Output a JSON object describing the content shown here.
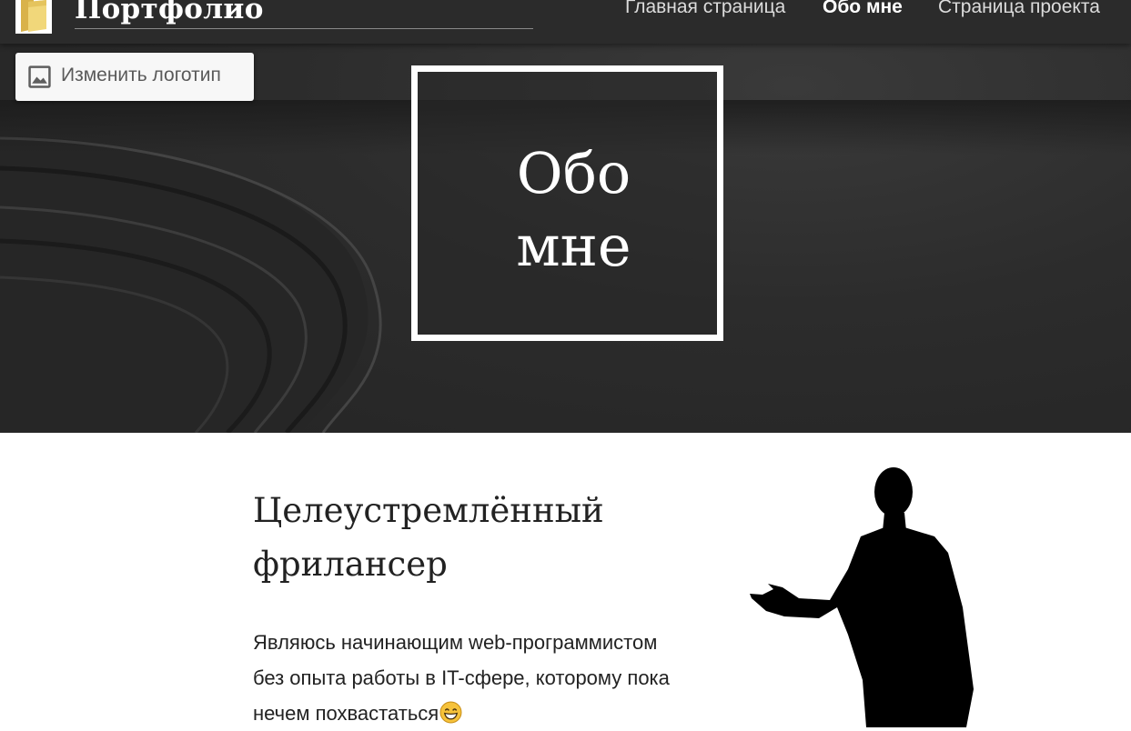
{
  "navbar": {
    "logo_icon": "folder-icon",
    "site_title": "Портфолио",
    "nav_items": [
      {
        "label": "Главная страница",
        "active": false
      },
      {
        "label": "Обо мне",
        "active": true
      },
      {
        "label": "Страница проекта",
        "active": false
      }
    ]
  },
  "change_logo": {
    "icon": "image-icon",
    "label": "Изменить логотип"
  },
  "hero": {
    "heading_line1": "Обо",
    "heading_line2": "мне"
  },
  "content": {
    "heading_line1": "Целеустремлённый",
    "heading_line2": "фрилансер",
    "text_line1": "Являюсь начинающим web-программистом",
    "text_line2": "без опыта работы в IT-сфере, которому пока",
    "text_line3": "нечем похвастаться",
    "emoji_icon": "grinning-face-icon"
  },
  "image": {
    "icon": "presenter-silhouette"
  },
  "colors": {
    "hero_background": "#2c2c2c",
    "navbar_background": "#2b2b2b",
    "accent_folder": "#e8c65c"
  }
}
